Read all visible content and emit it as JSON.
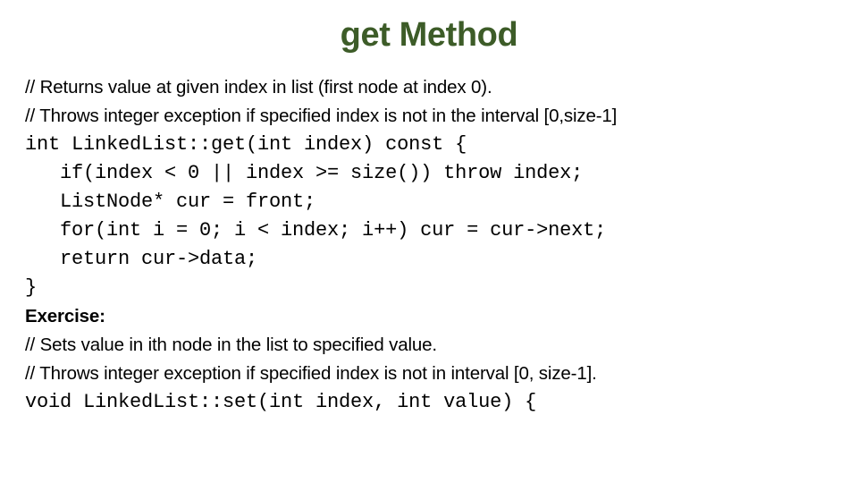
{
  "slide": {
    "title": "get Method",
    "title_color": "#3d5c28",
    "background_color": "#ffffff",
    "text_color": "#000000"
  },
  "lines": [
    {
      "kind": "prose",
      "bold": false,
      "text": "// Returns value at given index in list (first node at index 0)."
    },
    {
      "kind": "prose",
      "bold": false,
      "text": "// Throws integer exception if specified index is not in the interval [0,size-1]"
    },
    {
      "kind": "code",
      "bold": false,
      "text": "int LinkedList::get(int index) const {"
    },
    {
      "kind": "code",
      "bold": false,
      "text": "   if(index < 0 || index >= size()) throw index;"
    },
    {
      "kind": "code",
      "bold": false,
      "text": "   ListNode* cur = front;"
    },
    {
      "kind": "code",
      "bold": false,
      "text": "   for(int i = 0; i < index; i++) cur = cur->next;"
    },
    {
      "kind": "code",
      "bold": false,
      "text": "   return cur->data;"
    },
    {
      "kind": "code",
      "bold": false,
      "text": "}"
    },
    {
      "kind": "prose",
      "bold": true,
      "text": "Exercise:"
    },
    {
      "kind": "prose",
      "bold": false,
      "text": "// Sets value in ith node in the list to specified value."
    },
    {
      "kind": "prose",
      "bold": false,
      "text": "// Throws integer exception if specified index is not in interval [0, size-1]."
    },
    {
      "kind": "code",
      "bold": false,
      "text": "void LinkedList::set(int index, int value) {"
    }
  ]
}
